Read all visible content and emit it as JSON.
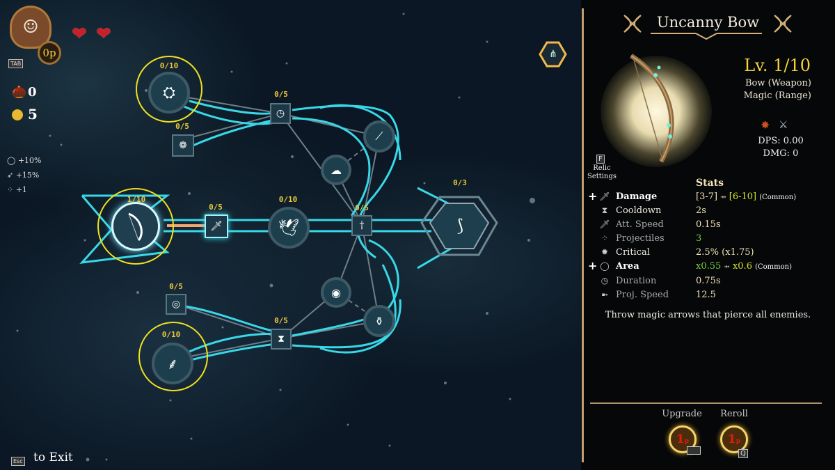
{
  "hud": {
    "tab_key": "TAB",
    "points_badge": "0p",
    "hearts": 2,
    "seeds_count": "0",
    "coins_count": "5",
    "buffs": [
      {
        "icon": "area-ring-icon",
        "value": "+10%"
      },
      {
        "icon": "speed-boot-icon",
        "value": "+15%"
      },
      {
        "icon": "projectiles-icon",
        "value": "+1"
      }
    ],
    "exit_key": "Esc",
    "exit_label": "to Exit"
  },
  "tree": {
    "nodes": [
      {
        "id": "root-bow",
        "progress": "1/10",
        "icon": "bow-icon"
      },
      {
        "id": "top-big",
        "progress": "0/10",
        "icon": "lantern-icon"
      },
      {
        "id": "top-small",
        "progress": "0/5",
        "icon": "eggs-icon"
      },
      {
        "id": "top-clock",
        "progress": "0/5",
        "icon": "clock-icon"
      },
      {
        "id": "mid-attack",
        "progress": "0/5",
        "icon": "attack-speed-icon"
      },
      {
        "id": "mid-eagle",
        "progress": "0/10",
        "icon": "eagle-icon"
      },
      {
        "id": "mid-sword",
        "progress": "0/5",
        "icon": "sword-icon"
      },
      {
        "id": "evolution",
        "progress": "0/3",
        "icon": "evolved-bow-icon"
      },
      {
        "id": "bot-ring",
        "progress": "0/5",
        "icon": "ring-icon"
      },
      {
        "id": "bot-big",
        "progress": "0/10",
        "icon": "feather-icon"
      },
      {
        "id": "bot-hourglass",
        "progress": "0/5",
        "icon": "hourglass-icon"
      }
    ]
  },
  "panel": {
    "title": "Uncanny Bow",
    "level": "Lv. 1/10",
    "type_line1": "Bow (Weapon)",
    "type_line2": "Magic (Range)",
    "dps": "DPS: 0.00",
    "dmg": "DMG: 0",
    "relic_key": "F",
    "relic_label_1": "Relic",
    "relic_label_2": "Settings",
    "stats_title": "Stats",
    "stats": [
      {
        "name": "Damage",
        "value": "[3-7]",
        "upgrade": "[6-10]",
        "rarity": "(Common)",
        "plus": true,
        "icon": "damage-icon"
      },
      {
        "name": "Cooldown",
        "value": "2s",
        "icon": "cooldown-icon"
      },
      {
        "name": "Att. Speed",
        "value": "0.15s",
        "icon": "att-speed-icon",
        "dim": true
      },
      {
        "name": "Projectiles",
        "value": "3",
        "icon": "projectiles-icon",
        "dim": true,
        "green": true
      },
      {
        "name": "Critical",
        "value": "2.5% (x1.75)",
        "icon": "critical-icon"
      },
      {
        "name": "Area",
        "value": "x0.55",
        "upgrade": "x0.6",
        "rarity": "(Common)",
        "plus": true,
        "icon": "area-icon",
        "green": true
      },
      {
        "name": "Duration",
        "value": "0.75s",
        "icon": "duration-icon",
        "dim": true
      },
      {
        "name": "Proj. Speed",
        "value": "12.5",
        "icon": "proj-speed-icon",
        "dim": true
      }
    ],
    "description": "Throw magic arrows that pierce all enemies.",
    "upgrade_label": "Upgrade",
    "reroll_label": "Reroll",
    "upgrade_cost": "1",
    "reroll_cost": "1",
    "cost_unit": "p",
    "upgrade_key": "Space",
    "reroll_key": "Q"
  },
  "colors": {
    "accent_gold": "#e9c83a",
    "line_cyan": "#38d8e8",
    "panel_border": "#c4a070"
  }
}
